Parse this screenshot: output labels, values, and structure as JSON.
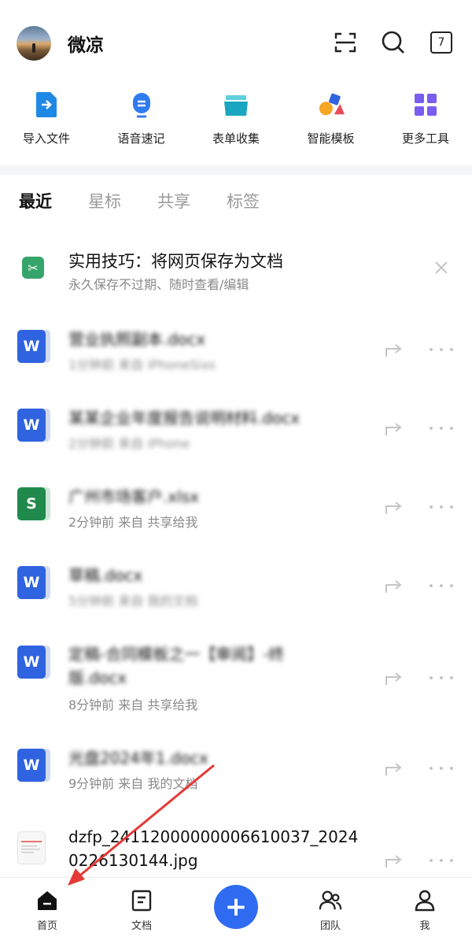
{
  "header": {
    "username": "微凉",
    "calendar_day": "7"
  },
  "tools": [
    {
      "label": "导入文件",
      "icon": "import-file-icon"
    },
    {
      "label": "语音速记",
      "icon": "voice-note-icon"
    },
    {
      "label": "表单收集",
      "icon": "form-collect-icon"
    },
    {
      "label": "智能模板",
      "icon": "smart-template-icon"
    },
    {
      "label": "更多工具",
      "icon": "more-tools-icon"
    }
  ],
  "tabs": [
    "最近",
    "星标",
    "共享",
    "标签"
  ],
  "tip": {
    "title": "实用技巧：将网页保存为文档",
    "subtitle": "永久保存不过期、随时查看/编辑"
  },
  "files": [
    {
      "type": "word",
      "badge": "W",
      "name": "营业执照副本.docx",
      "meta": "1分钟前 来自 iPhoneSixs"
    },
    {
      "type": "word",
      "badge": "W",
      "name": "某某企业年度报告说明材料.docx",
      "meta": "2分钟前 来自 iPhone"
    },
    {
      "type": "sheet",
      "badge": "S",
      "name": "广州市场客户.xlsx",
      "meta": "2分钟前 来自 共享给我"
    },
    {
      "type": "word",
      "badge": "W",
      "name": "草稿.docx",
      "meta": "5分钟前 来自 我的文档"
    },
    {
      "type": "word",
      "badge": "W",
      "name": "定稿-合同模板之一【审阅】-终版.docx",
      "meta": "8分钟前 来自 共享给我"
    },
    {
      "type": "word",
      "badge": "W",
      "name": "光盘2024年1.docx",
      "meta": "9分钟前 来自 我的文档"
    },
    {
      "type": "img",
      "badge": "",
      "name": "dzfp_24112000000006610037_20240226130144.jpg",
      "meta": ""
    }
  ],
  "bottom_nav": [
    {
      "label": "首页",
      "icon": "home-icon"
    },
    {
      "label": "文档",
      "icon": "document-icon"
    },
    {
      "label": "团队",
      "icon": "team-icon"
    },
    {
      "label": "我",
      "icon": "profile-icon"
    }
  ],
  "fab_label": "+",
  "colors": {
    "accent": "#2e6bf0",
    "word": "#2f63e0",
    "sheet": "#1f8a4c",
    "annotation_arrow": "#e53935"
  }
}
